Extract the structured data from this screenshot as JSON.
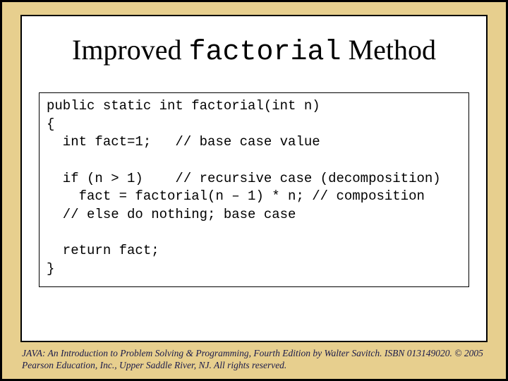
{
  "title": {
    "part1": "Improved ",
    "code": "factorial",
    "part2": " Method"
  },
  "code": "public static int factorial(int n)\n{\n  int fact=1;   // base case value\n\n  if (n > 1)    // recursive case (decomposition)\n    fact = factorial(n – 1) * n; // composition\n  // else do nothing; base case\n\n  return fact;\n}",
  "footer": "JAVA: An Introduction to Problem Solving & Programming, Fourth Edition by Walter Savitch.\nISBN 013149020. © 2005 Pearson Education, Inc., Upper Saddle River, NJ. All rights reserved."
}
